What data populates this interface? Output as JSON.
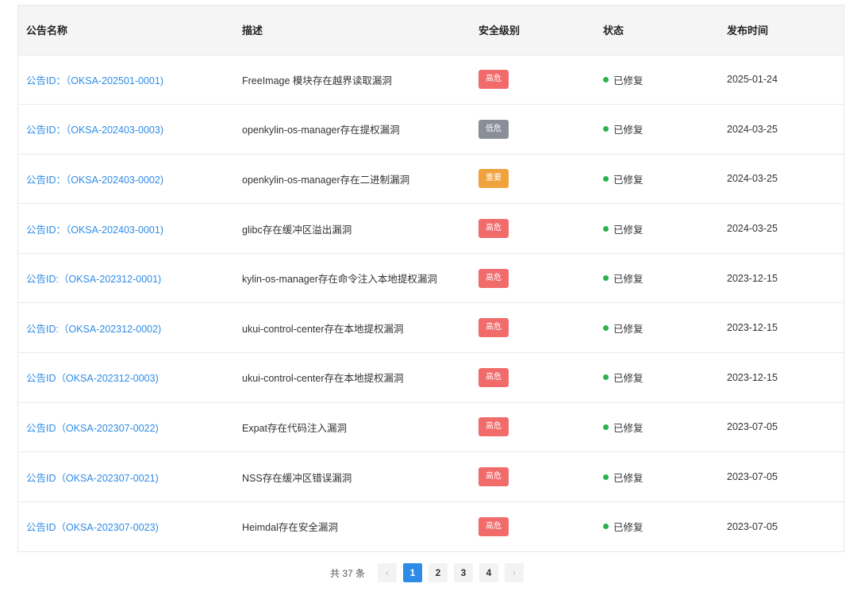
{
  "table": {
    "columns": [
      "公告名称",
      "描述",
      "安全级别",
      "状态",
      "发布时间"
    ],
    "rows": [
      {
        "id": "公告ID：（OKSA-202501-0001)",
        "desc": "FreeImage 模块存在越界读取漏洞",
        "level": "高危",
        "level_color": "#f26b6b",
        "status": "已修复",
        "date": "2025-01-24"
      },
      {
        "id": "公告ID：（OKSA-202403-0003)",
        "desc": "openkylin-os-manager存在提权漏洞",
        "level": "低危",
        "level_color": "#8a8e99",
        "status": "已修复",
        "date": "2024-03-25"
      },
      {
        "id": "公告ID：（OKSA-202403-0002)",
        "desc": "openkylin-os-manager存在二进制漏洞",
        "level": "重要",
        "level_color": "#f0a23c",
        "status": "已修复",
        "date": "2024-03-25"
      },
      {
        "id": "公告ID：（OKSA-202403-0001)",
        "desc": "glibc存在缓冲区溢出漏洞",
        "level": "高危",
        "level_color": "#f26b6b",
        "status": "已修复",
        "date": "2024-03-25"
      },
      {
        "id": "公告ID:（OKSA-202312-0001)",
        "desc": "kylin-os-manager存在命令注入本地提权漏洞",
        "level": "高危",
        "level_color": "#f26b6b",
        "status": "已修复",
        "date": "2023-12-15"
      },
      {
        "id": "公告ID:（OKSA-202312-0002)",
        "desc": "ukui-control-center存在本地提权漏洞",
        "level": "高危",
        "level_color": "#f26b6b",
        "status": "已修复",
        "date": "2023-12-15"
      },
      {
        "id": "公告ID（OKSA-202312-0003)",
        "desc": "ukui-control-center存在本地提权漏洞",
        "level": "高危",
        "level_color": "#f26b6b",
        "status": "已修复",
        "date": "2023-12-15"
      },
      {
        "id": "公告ID（OKSA-202307-0022)",
        "desc": "Expat存在代码注入漏洞",
        "level": "高危",
        "level_color": "#f26b6b",
        "status": "已修复",
        "date": "2023-07-05"
      },
      {
        "id": "公告ID（OKSA-202307-0021)",
        "desc": "NSS存在缓冲区错误漏洞",
        "level": "高危",
        "level_color": "#f26b6b",
        "status": "已修复",
        "date": "2023-07-05"
      },
      {
        "id": "公告ID（OKSA-202307-0023)",
        "desc": "Heimdal存在安全漏洞",
        "level": "高危",
        "level_color": "#f26b6b",
        "status": "已修复",
        "date": "2023-07-05"
      }
    ]
  },
  "status_dot_color": "#2bb24c",
  "pagination": {
    "total_label": "共 37 条",
    "prev_icon": "chevron-left-icon",
    "next_icon": "chevron-right-icon",
    "pages": [
      "1",
      "2",
      "3",
      "4"
    ],
    "current_page": "1"
  }
}
